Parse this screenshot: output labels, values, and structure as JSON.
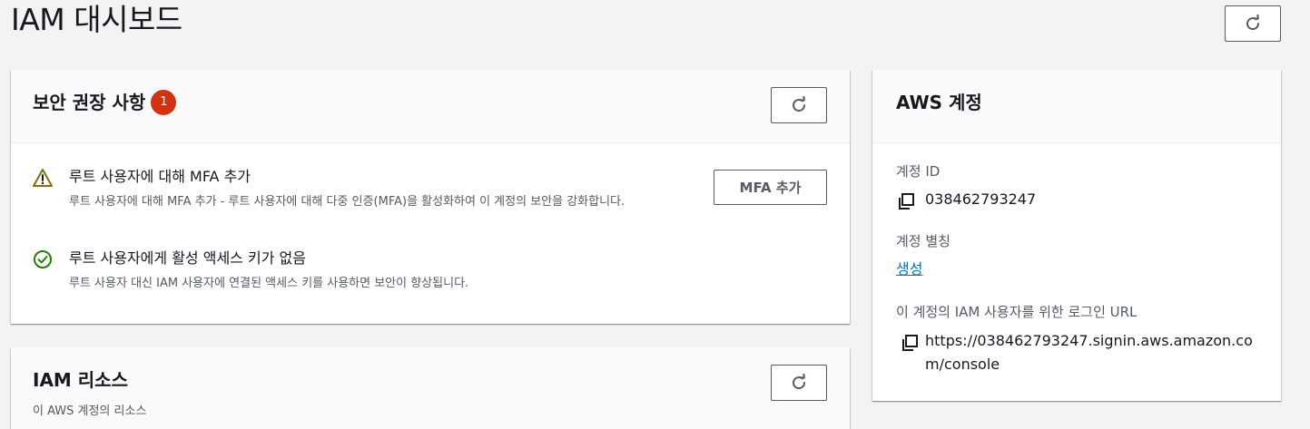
{
  "page": {
    "title": "IAM 대시보드"
  },
  "security": {
    "title": "보안 권장 사항",
    "badge_count": "1",
    "items": [
      {
        "status": "warning",
        "title": "루트 사용자에 대해 MFA 추가",
        "description": "루트 사용자에 대해 MFA 추가 - 루트 사용자에 대해 다중 인증(MFA)을 활성화하여 이 계정의 보안을 강화합니다.",
        "action_label": "MFA 추가"
      },
      {
        "status": "success",
        "title": "루트 사용자에게 활성 액세스 키가 없음",
        "description": "루트 사용자 대신 IAM 사용자에 연결된 액세스 키를 사용하면 보안이 향상됩니다."
      }
    ]
  },
  "resources": {
    "title": "IAM 리소스",
    "subtitle": "이 AWS 계정의 리소스"
  },
  "account": {
    "title": "AWS 계정",
    "id_label": "계정 ID",
    "id_value": "038462793247",
    "alias_label": "계정 별칭",
    "alias_action": "생성",
    "signin_label": "이 계정의 IAM 사용자를 위한 로그인 URL",
    "signin_url_line1": "https://038462793247.signin.aws.amazon.co",
    "signin_url_line2": "m/console"
  },
  "colors": {
    "warning": "#8a6d00",
    "success": "#1d8102",
    "badge": "#d13212",
    "link": "#0073bb"
  },
  "icons": {
    "refresh": "refresh-icon",
    "warning": "warning-icon",
    "success": "check-circle-icon",
    "copy": "copy-icon"
  }
}
